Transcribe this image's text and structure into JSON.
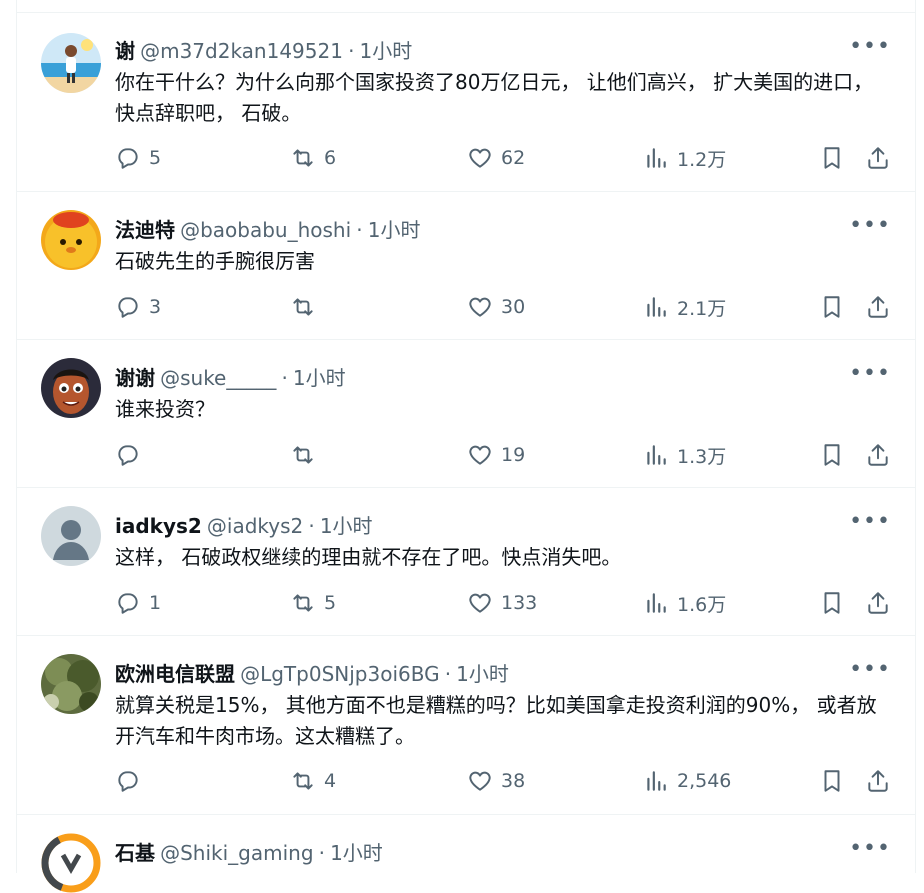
{
  "more_label": "•••",
  "tweets": [
    {
      "name": "谢",
      "handle": "@m37d2kan149521",
      "dot": "·",
      "time": "1小时",
      "text": "你在干什么？为什么向那个国家投资了80万亿日元， 让他们高兴， 扩大美国的进口， 快点辞职吧， 石破。",
      "replies": "5",
      "retweets": "6",
      "likes": "62",
      "views": "1.2万",
      "avatar": "beach-person-avatar"
    },
    {
      "name": "法迪特",
      "handle": "@baobabu_hoshi",
      "dot": "·",
      "time": "1小时",
      "text": "石破先生的手腕很厉害",
      "replies": "3",
      "retweets": "",
      "likes": "30",
      "views": "2.1万",
      "avatar": "yellow-chick-avatar"
    },
    {
      "name": "谢谢",
      "handle": "@suke_____",
      "dot": "·",
      "time": "1小时",
      "text": "谁来投资？",
      "replies": "",
      "retweets": "",
      "likes": "19",
      "views": "1.3万",
      "avatar": "cartoon-face-avatar"
    },
    {
      "name": "iadkys2",
      "handle": "@iadkys2",
      "dot": "·",
      "time": "1小时",
      "text": "这样， 石破政权继续的理由就不存在了吧。快点消失吧。",
      "replies": "1",
      "retweets": "5",
      "likes": "133",
      "views": "1.6万",
      "avatar": "default-user-avatar"
    },
    {
      "name": "欧洲电信联盟",
      "handle": "@LgTp0SNjp3oi6BG",
      "dot": "·",
      "time": "1小时",
      "text": "就算关税是15%， 其他方面不也是糟糕的吗？比如美国拿走投资利润的90%， 或者放开汽车和牛肉市场。这太糟糕了。",
      "replies": "",
      "retweets": "4",
      "likes": "38",
      "views": "2,546",
      "avatar": "tree-photo-avatar"
    },
    {
      "name": "石基",
      "handle": "@Shiki_gaming",
      "dot": "·",
      "time": "1小时",
      "text": "",
      "avatar": "overwatch-logo-avatar"
    }
  ],
  "colors": {
    "text": "#0f1419",
    "secondary": "#536471",
    "divider": "#eff3f4"
  }
}
